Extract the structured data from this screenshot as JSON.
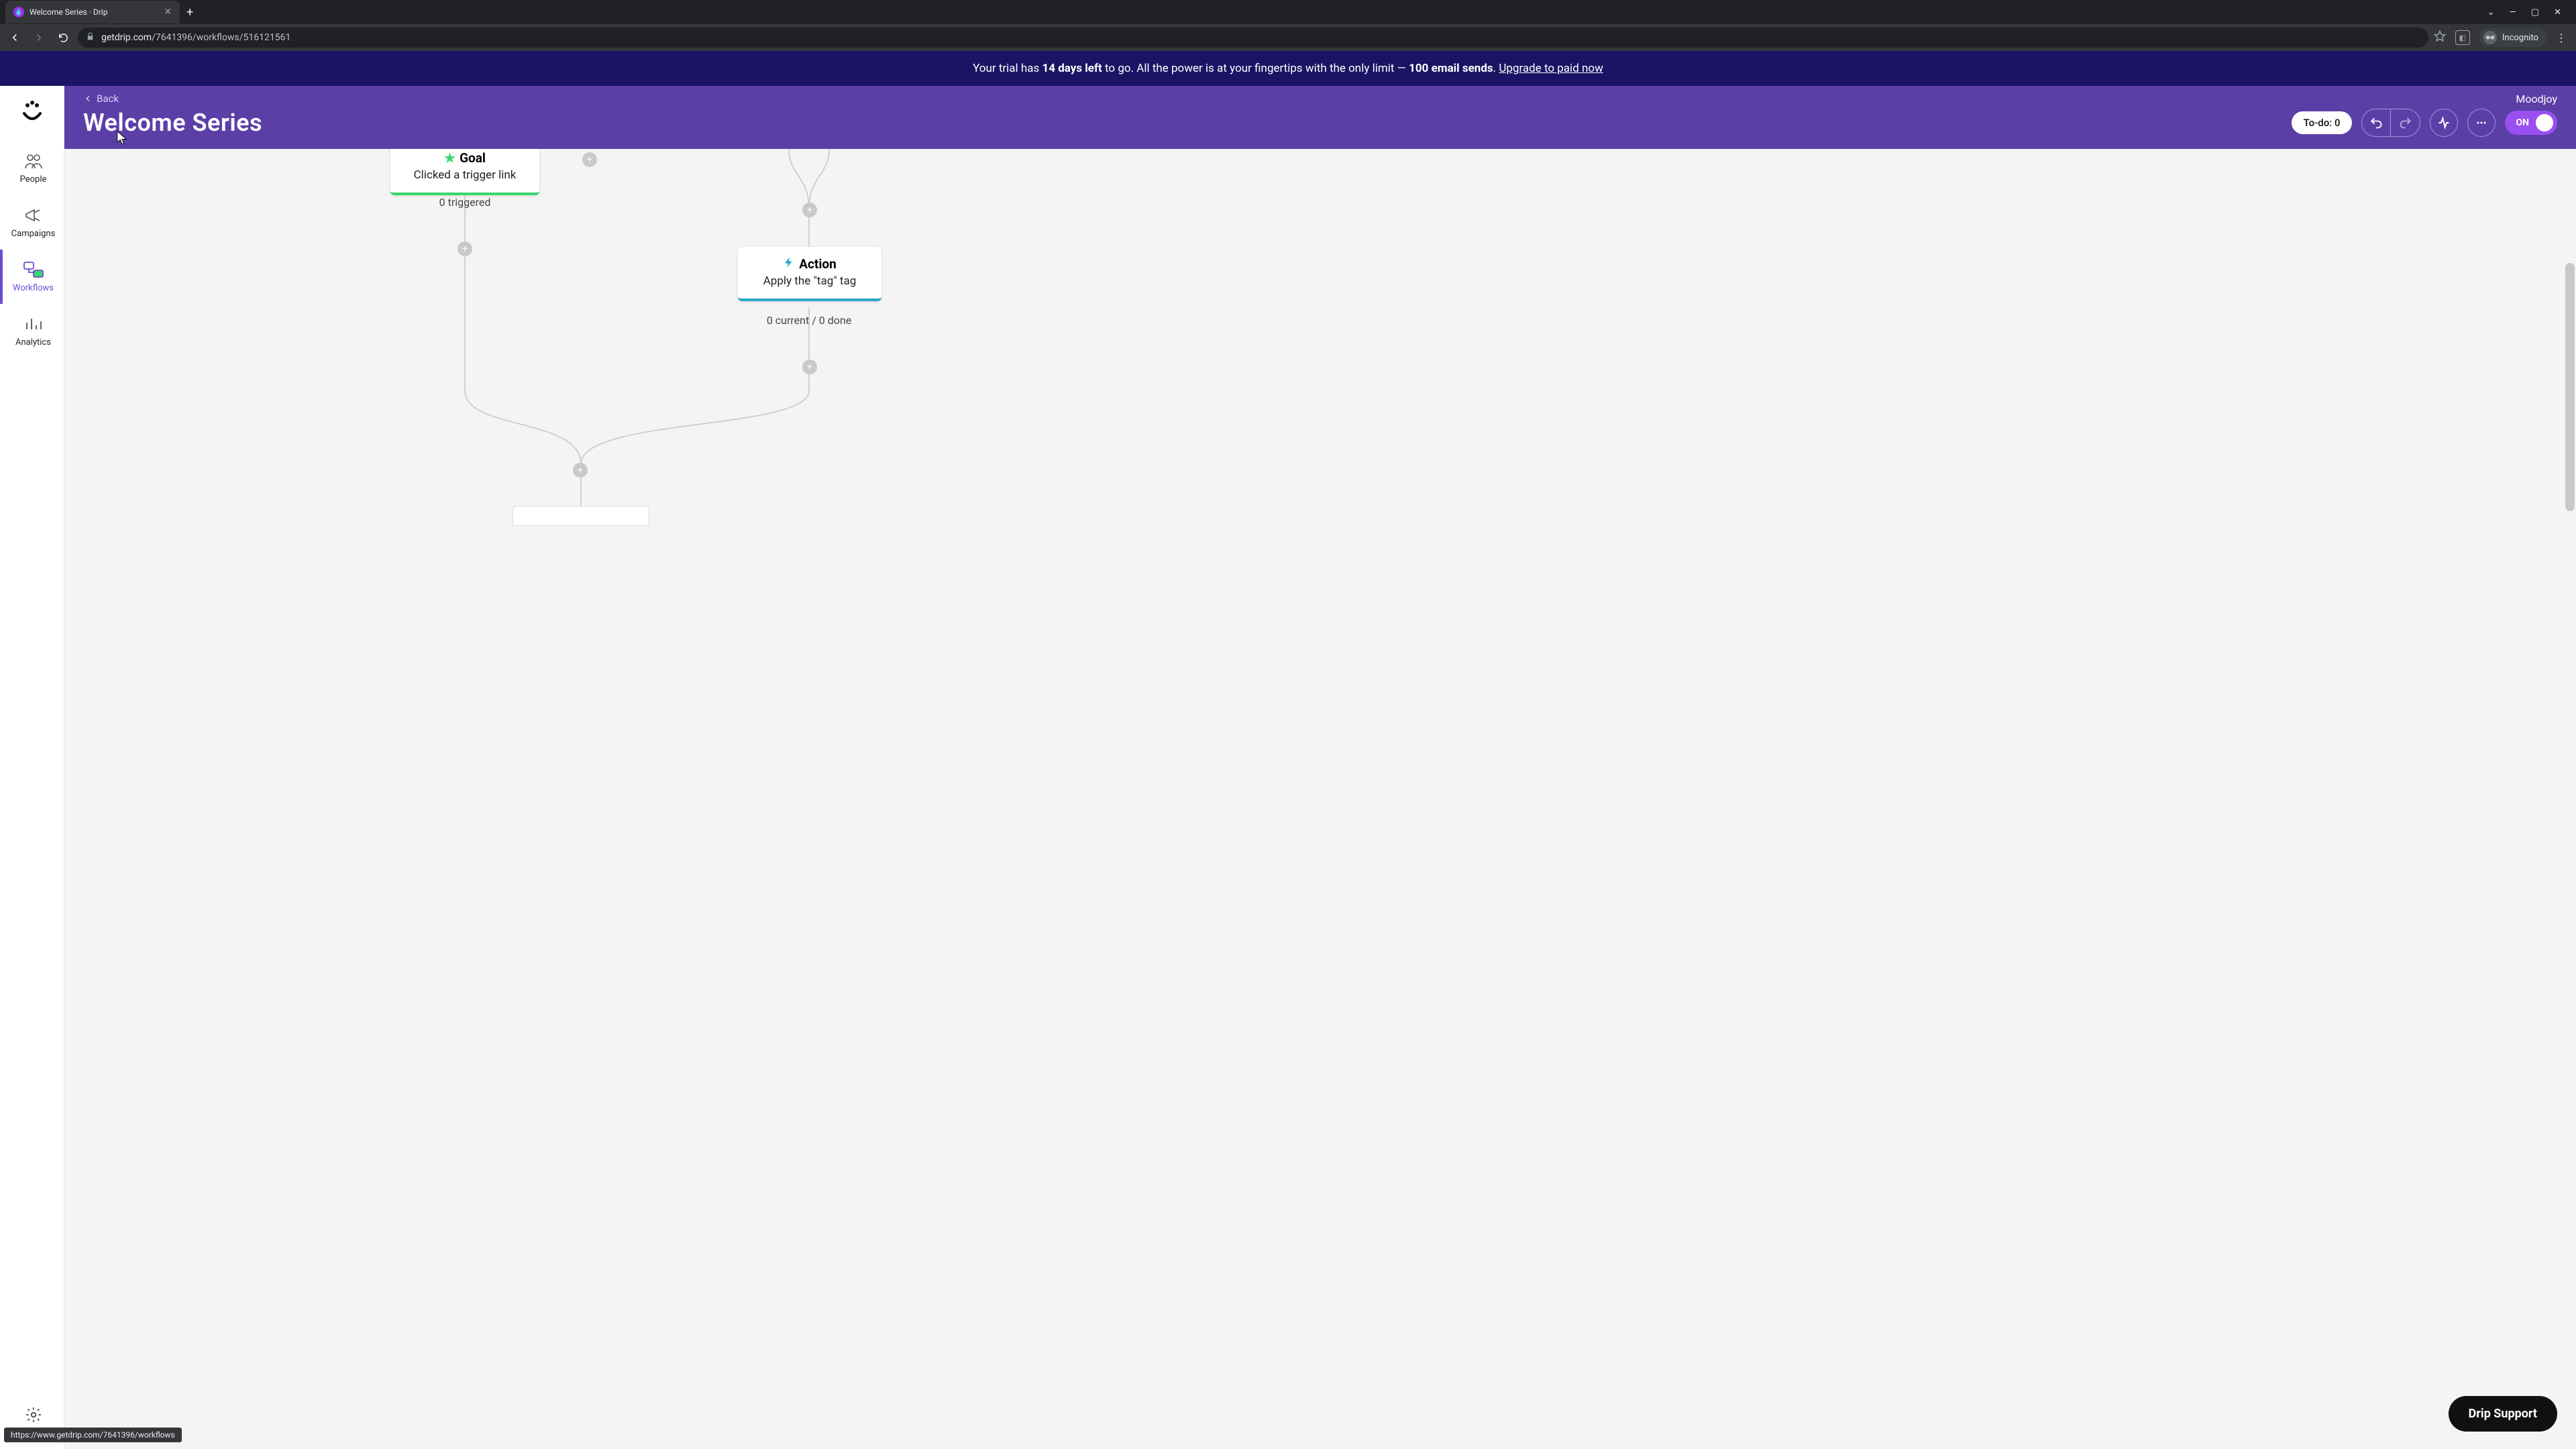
{
  "browser": {
    "tab_title": "Welcome Series · Drip",
    "url_host": "getdrip.com",
    "url_path": "/7641396/workflows/516121561",
    "incognito_label": "Incognito"
  },
  "trial": {
    "prefix": "Your trial has ",
    "days": "14 days left",
    "mid": " to go. All the power is at your fingertips with the only limit — ",
    "sends": "100 email sends",
    "suffix": ". ",
    "cta": "Upgrade to paid now"
  },
  "sidebar": {
    "items": [
      {
        "label": "People"
      },
      {
        "label": "Campaigns"
      },
      {
        "label": "Workflows"
      },
      {
        "label": "Analytics"
      }
    ],
    "settings": "Settings"
  },
  "header": {
    "back": "Back",
    "title": "Welcome Series",
    "org": "Moodjoy",
    "todo": "To-do: 0",
    "toggle": "ON"
  },
  "nodes": {
    "goal": {
      "title": "Goal",
      "subtitle": "Clicked a trigger link",
      "meta": "0 triggered"
    },
    "action": {
      "title": "Action",
      "subtitle": "Apply the \"tag\" tag",
      "meta": "0 current / 0 done"
    }
  },
  "support": "Drip Support",
  "status_url": "https://www.getdrip.com/7641396/workflows"
}
